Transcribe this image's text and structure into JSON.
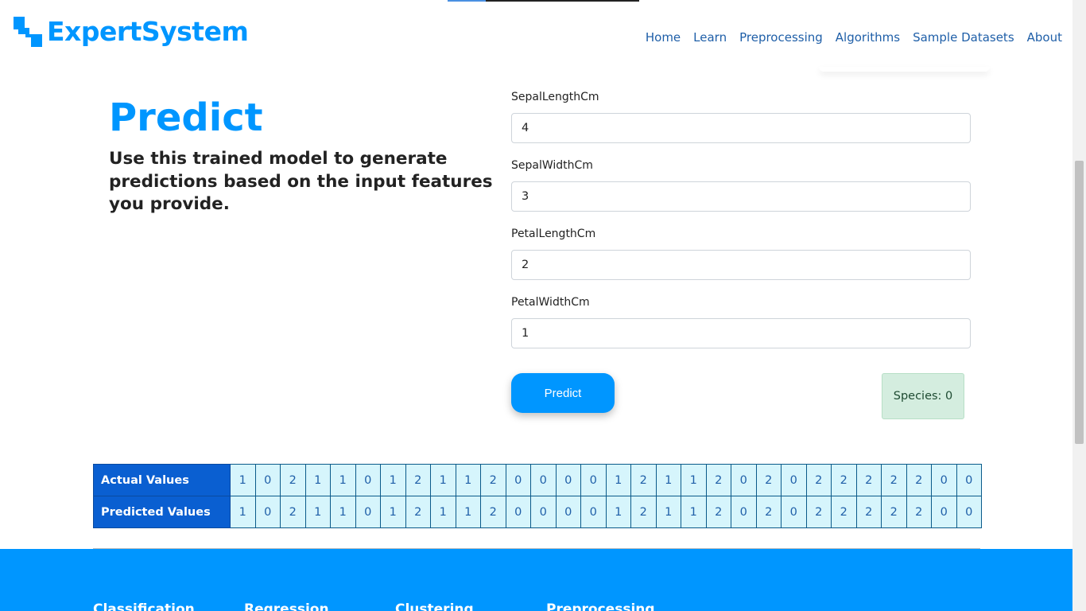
{
  "brand": {
    "name": "ExpertSystem",
    "color": "#0096ff"
  },
  "nav": {
    "items": [
      "Home",
      "Learn",
      "Preprocessing",
      "Algorithms",
      "Sample Datasets",
      "About"
    ]
  },
  "hero": {
    "title": "Predict",
    "description": "Use this trained model to generate predictions based on the input features you provide."
  },
  "form": {
    "fields": [
      {
        "label": "SepalLengthCm",
        "value": "4"
      },
      {
        "label": "SepalWidthCm",
        "value": "3"
      },
      {
        "label": "PetalLengthCm",
        "value": "2"
      },
      {
        "label": "PetalWidthCm",
        "value": "1"
      }
    ],
    "predict_label": "Predict",
    "result_text": "Species: 0"
  },
  "results": {
    "actual_label": "Actual Values",
    "predicted_label": "Predicted Values",
    "actual": [
      1,
      0,
      2,
      1,
      1,
      0,
      1,
      2,
      1,
      1,
      2,
      0,
      0,
      0,
      0,
      1,
      2,
      1,
      1,
      2,
      0,
      2,
      0,
      2,
      2,
      2,
      2,
      2,
      0,
      0
    ],
    "predicted": [
      1,
      0,
      2,
      1,
      1,
      0,
      1,
      2,
      1,
      1,
      2,
      0,
      0,
      0,
      0,
      1,
      2,
      1,
      1,
      2,
      0,
      2,
      0,
      2,
      2,
      2,
      2,
      2,
      0,
      0
    ]
  },
  "footer": {
    "columns": [
      "Classification",
      "Regression",
      "Clustering",
      "Preprocessing"
    ]
  }
}
